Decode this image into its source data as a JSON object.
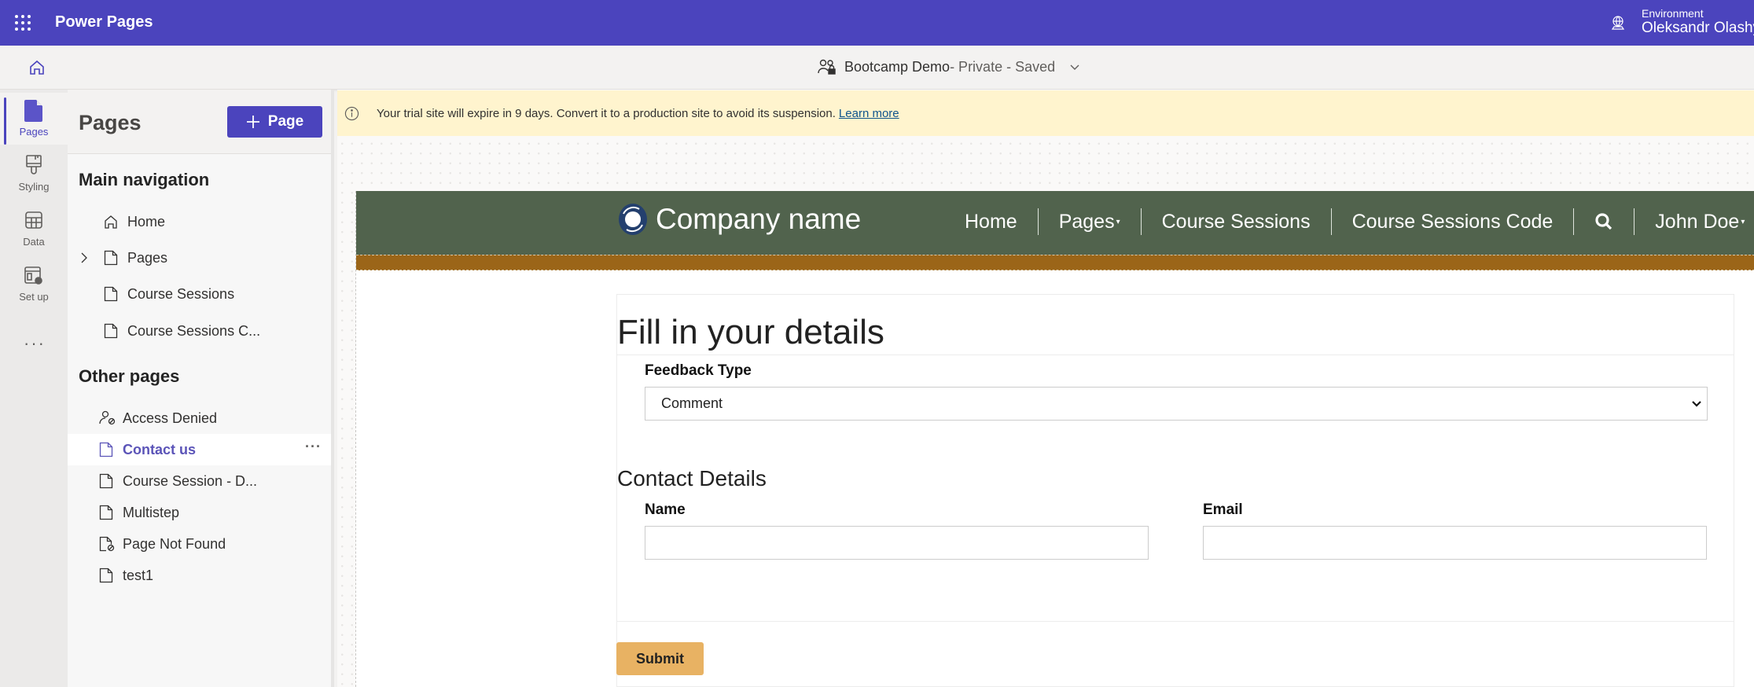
{
  "topbar": {
    "app_title": "Power Pages",
    "environment_label": "Environment",
    "environment_name": "Oleksandr Olashyn"
  },
  "subbar": {
    "site_name": "Bootcamp Demo",
    "site_status": " - Private - Saved"
  },
  "rail": {
    "items": [
      {
        "label": "Pages",
        "icon": "page-icon",
        "active": true
      },
      {
        "label": "Styling",
        "icon": "paintbrush-icon",
        "active": false
      },
      {
        "label": "Data",
        "icon": "table-icon",
        "active": false
      },
      {
        "label": "Set up",
        "icon": "setup-gear-icon",
        "active": false
      }
    ],
    "more": "···"
  },
  "panel": {
    "title": "Pages",
    "add_button": "Page",
    "main_nav_title": "Main navigation",
    "main_nav": [
      {
        "label": "Home",
        "icon": "home-icon"
      },
      {
        "label": "Pages",
        "icon": "page-icon",
        "expandable": true
      },
      {
        "label": "Course Sessions",
        "icon": "page-icon"
      },
      {
        "label": "Course Sessions C...",
        "icon": "page-icon"
      }
    ],
    "other_title": "Other pages",
    "other_pages": [
      {
        "label": "Access Denied",
        "icon": "person-blocked-icon"
      },
      {
        "label": "Contact us",
        "icon": "page-icon",
        "selected": true
      },
      {
        "label": "Course Session - D...",
        "icon": "page-icon"
      },
      {
        "label": "Multistep",
        "icon": "page-icon"
      },
      {
        "label": "Page Not Found",
        "icon": "page-blocked-icon"
      },
      {
        "label": "test1",
        "icon": "page-icon"
      }
    ],
    "item_more": "···"
  },
  "banner": {
    "message": "Your trial site will expire in 9 days. Convert it to a production site to avoid its suspension.",
    "link": "Learn more"
  },
  "site": {
    "brand": "Company name",
    "menu": [
      {
        "label": "Home",
        "dropdown": false
      },
      {
        "label": "Pages",
        "dropdown": true
      },
      {
        "label": "Course Sessions",
        "dropdown": false
      },
      {
        "label": "Course Sessions Code",
        "dropdown": false
      },
      {
        "label": "",
        "icon": "search-icon"
      },
      {
        "label": "John Doe",
        "dropdown": true
      }
    ],
    "caret": "▾",
    "colors": {
      "header": "#51634d",
      "stripe": "#9b6518",
      "submit": "#e8b263"
    }
  },
  "form": {
    "title": "Fill in your details",
    "feedback_type_label": "Feedback Type",
    "feedback_type_value": "Comment",
    "contact_section": "Contact Details",
    "name_label": "Name",
    "name_value": "",
    "email_label": "Email",
    "email_value": "",
    "submit_label": "Submit"
  },
  "theme": {
    "accent": "#4b44bd",
    "banner_bg": "#fff4ce"
  }
}
